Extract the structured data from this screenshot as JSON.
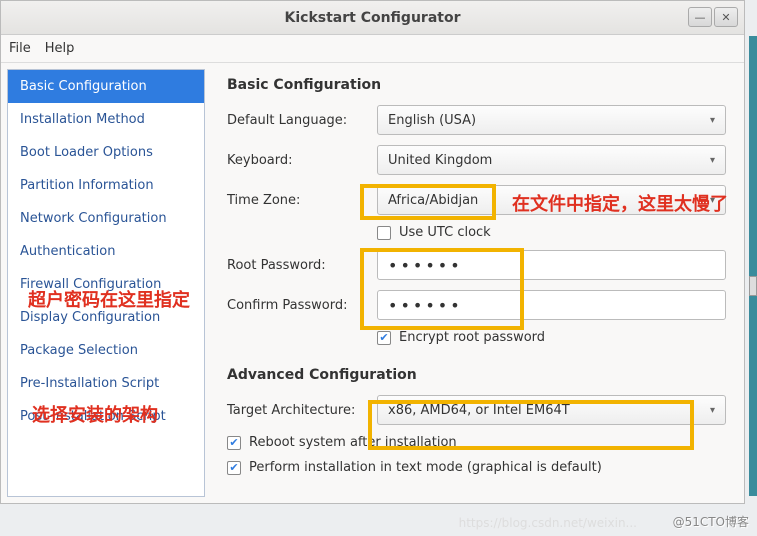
{
  "window": {
    "title": "Kickstart Configurator"
  },
  "titlebar_buttons": {
    "min": "—",
    "close": "✕"
  },
  "menubar": {
    "file": "File",
    "help": "Help"
  },
  "sidebar": {
    "items": [
      {
        "label": "Basic Configuration",
        "selected": true
      },
      {
        "label": "Installation Method"
      },
      {
        "label": "Boot Loader Options"
      },
      {
        "label": "Partition Information"
      },
      {
        "label": "Network Configuration"
      },
      {
        "label": "Authentication"
      },
      {
        "label": "Firewall Configuration"
      },
      {
        "label": "Display Configuration"
      },
      {
        "label": "Package Selection"
      },
      {
        "label": "Pre-Installation Script"
      },
      {
        "label": "Post-Installation Script"
      }
    ]
  },
  "main": {
    "section_title": "Basic Configuration",
    "default_language_label": "Default Language:",
    "default_language_value": "English (USA)",
    "keyboard_label": "Keyboard:",
    "keyboard_value": "United Kingdom",
    "timezone_label": "Time Zone:",
    "timezone_value": "Africa/Abidjan",
    "utc_label": "Use UTC clock",
    "utc_checked": false,
    "root_password_label": "Root Password:",
    "root_password_value": "••••••",
    "confirm_password_label": "Confirm Password:",
    "confirm_password_value": "••••••",
    "encrypt_label": "Encrypt root password",
    "encrypt_checked": true,
    "advanced_title": "Advanced Configuration",
    "target_arch_label": "Target Architecture:",
    "target_arch_value": "x86, AMD64, or Intel EM64T",
    "reboot_label": "Reboot system after installation",
    "reboot_checked": true,
    "textmode_label": "Perform installation in text mode (graphical is default)",
    "textmode_checked": true
  },
  "annotations": {
    "a1": "在文件中指定，这里太慢了",
    "a2": "超户密码在这里指定",
    "a3": "选择安装的架构"
  },
  "watermark": "@51CTO博客",
  "watermark_url": "https://blog.csdn.net/weixin..."
}
